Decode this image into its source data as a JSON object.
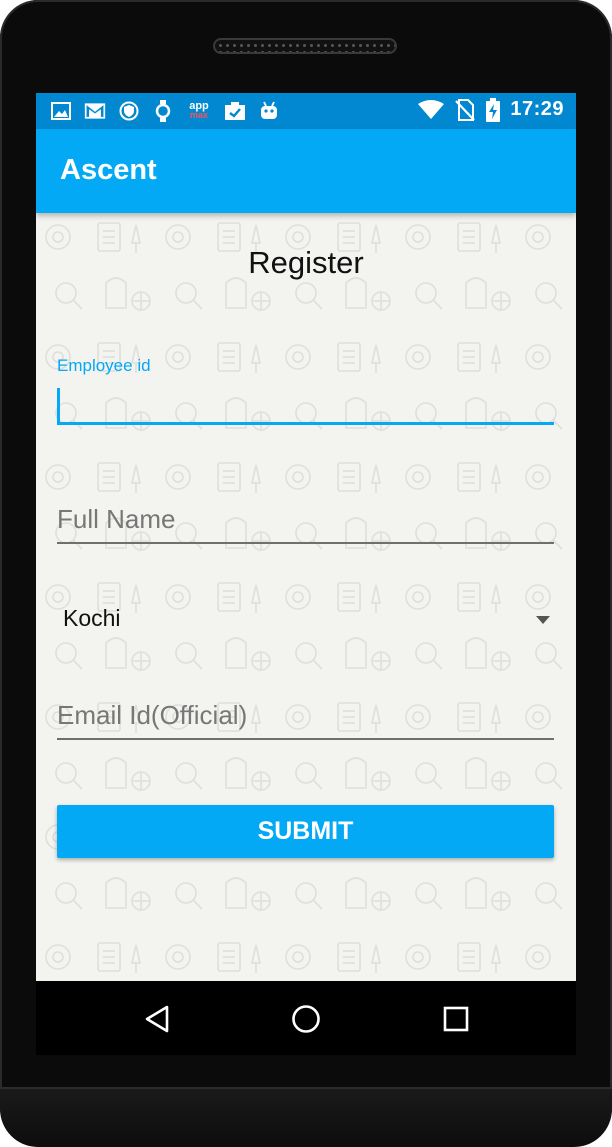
{
  "status_bar": {
    "left_icons": [
      "image-icon",
      "gmail-icon",
      "shield-icon",
      "watch-icon",
      "appmax-icon",
      "clipboard-check-icon",
      "android-icon"
    ],
    "appmax_text_top": "app",
    "appmax_text_bottom": "max",
    "right_icons": [
      "wifi-icon",
      "no-sim-icon",
      "battery-charging-icon"
    ],
    "time": "17:29"
  },
  "app_bar": {
    "title": "Ascent"
  },
  "form": {
    "heading": "Register",
    "employee_id": {
      "label": "Employee id",
      "value": ""
    },
    "full_name": {
      "placeholder": "Full Name",
      "value": ""
    },
    "location": {
      "selected": "Kochi"
    },
    "email": {
      "placeholder": "Email Id(Official)",
      "value": ""
    },
    "submit_label": "SUBMIT"
  },
  "nav_bar": {
    "buttons": [
      "back-icon",
      "home-icon",
      "recents-icon"
    ]
  },
  "colors": {
    "status_bar": "#0288d1",
    "accent": "#03a9f4",
    "background": "#f3f3ef"
  }
}
